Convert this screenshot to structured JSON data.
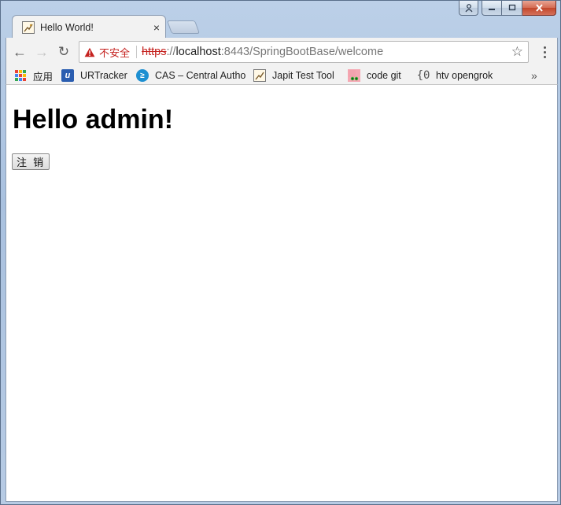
{
  "window": {
    "caption_buttons": {
      "minimize": "—",
      "maximize": "□",
      "close": "✕"
    }
  },
  "tab": {
    "title": "Hello World!",
    "close_glyph": "×"
  },
  "toolbar": {
    "back_glyph": "←",
    "forward_glyph": "→",
    "reload_glyph": "↻",
    "security_label": "不安全",
    "url_scheme": "https",
    "url_separator": "://",
    "url_host": "localhost",
    "url_rest": ":8443/SpringBootBase/welcome",
    "bookmark_star_glyph": "☆",
    "warning_color": "#c5221f"
  },
  "bookmarks": {
    "items": [
      {
        "label": "应用",
        "icon": "apps-grid-icon"
      },
      {
        "label": "URTracker",
        "icon": "urtracker-icon"
      },
      {
        "label": "CAS – Central Autho",
        "icon": "cas-icon"
      },
      {
        "label": "Japit Test Tool",
        "icon": "image-icon"
      },
      {
        "label": "code git",
        "icon": "git-icon"
      },
      {
        "label": "htv opengrok",
        "icon": "braces-icon"
      }
    ],
    "more_glyph": "»",
    "htv_icon_text": "{0"
  },
  "page": {
    "heading": "Hello admin!",
    "logout_label": "注 销"
  }
}
